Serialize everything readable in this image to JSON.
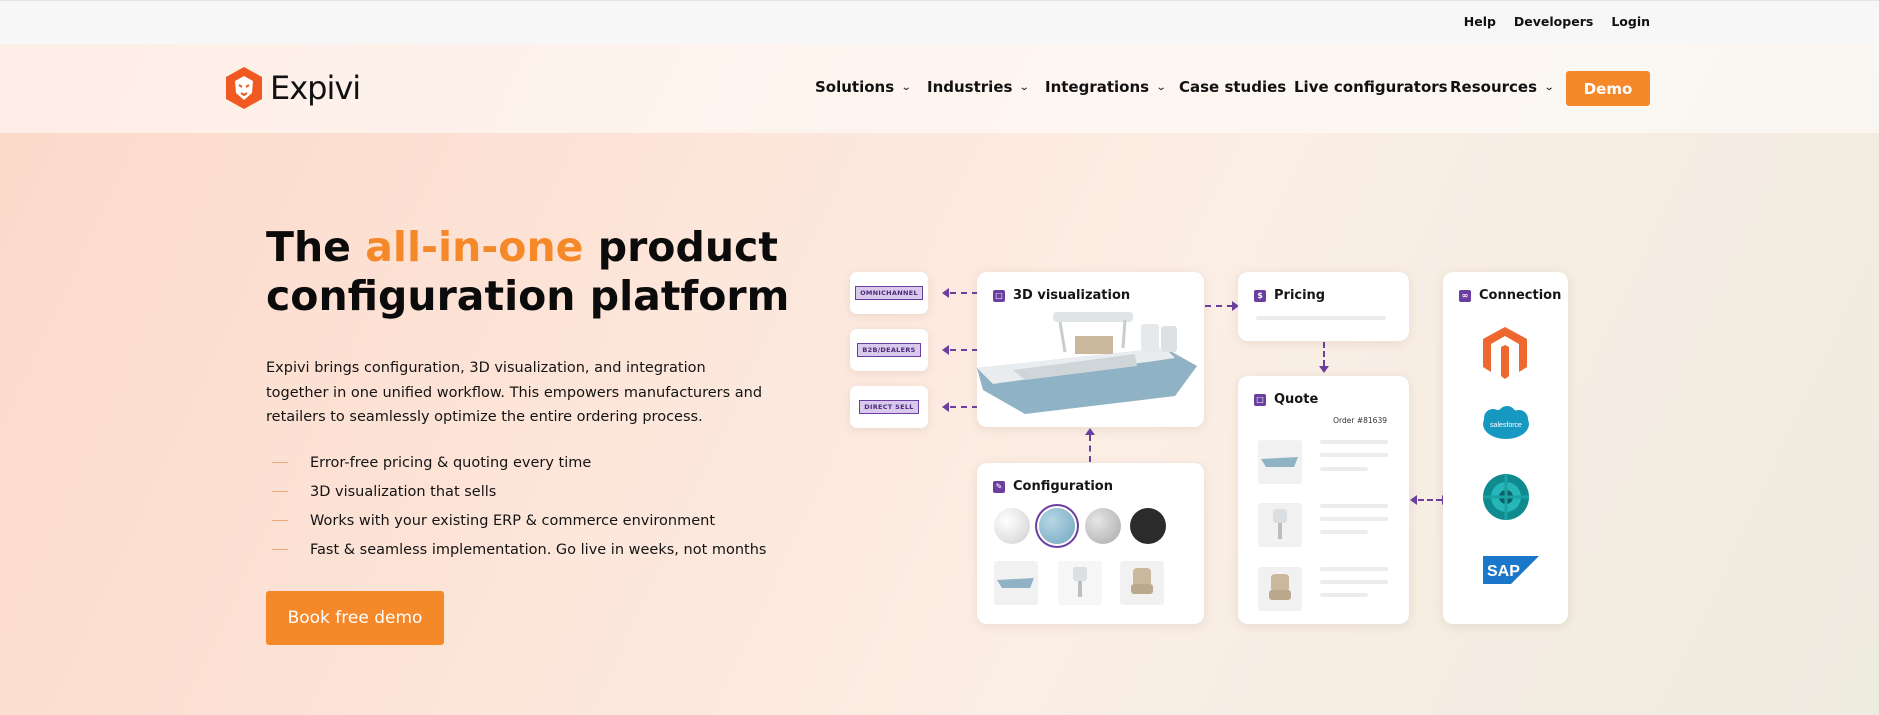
{
  "utility_links": [
    "Help",
    "Developers",
    "Login"
  ],
  "brand": {
    "name": "Expivi",
    "logo_icon": "lion-head-icon",
    "accent": "#f5892a",
    "logo_color": "#f05a22"
  },
  "nav": {
    "items": [
      {
        "label": "Solutions",
        "dropdown": true
      },
      {
        "label": "Industries",
        "dropdown": true
      },
      {
        "label": "Integrations",
        "dropdown": true
      },
      {
        "label": "Case studies",
        "dropdown": false
      },
      {
        "label": "Live configurators",
        "dropdown": false
      },
      {
        "label": "Resources",
        "dropdown": true
      }
    ],
    "demo_label": "Demo"
  },
  "hero": {
    "headline_before": "The ",
    "headline_accent": "all-in-one",
    "headline_after": " product configuration platform",
    "intro": "Expivi brings configuration, 3D visualization, and integration together in one unified workflow. This empowers manufacturers and retailers to seamlessly optimize the entire ordering process.",
    "bullets": [
      "Error-free pricing & quoting every time",
      "3D visualization that sells",
      "Works with your existing ERP & commerce environment",
      "Fast & seamless implementation. Go live in weeks, not months"
    ],
    "cta_label": "Book free demo"
  },
  "diagram": {
    "channels": [
      "OMNICHANNEL",
      "B2B/DEALERS",
      "DIRECT SELL"
    ],
    "visualization_title": "3D visualization",
    "pricing_title": "Pricing",
    "quote_title": "Quote",
    "quote_order": "Order #81639",
    "configuration_title": "Configuration",
    "connection_title": "Connection",
    "connection_logos": [
      "magento-logo",
      "salesforce-logo",
      "dynamics-logo",
      "sap-logo"
    ],
    "swatch_colors": [
      "#d9d9d9",
      "#7fb3c9",
      "#bdbdbd",
      "#2b2b2b"
    ],
    "arrow_color": "#6b3fa0"
  }
}
